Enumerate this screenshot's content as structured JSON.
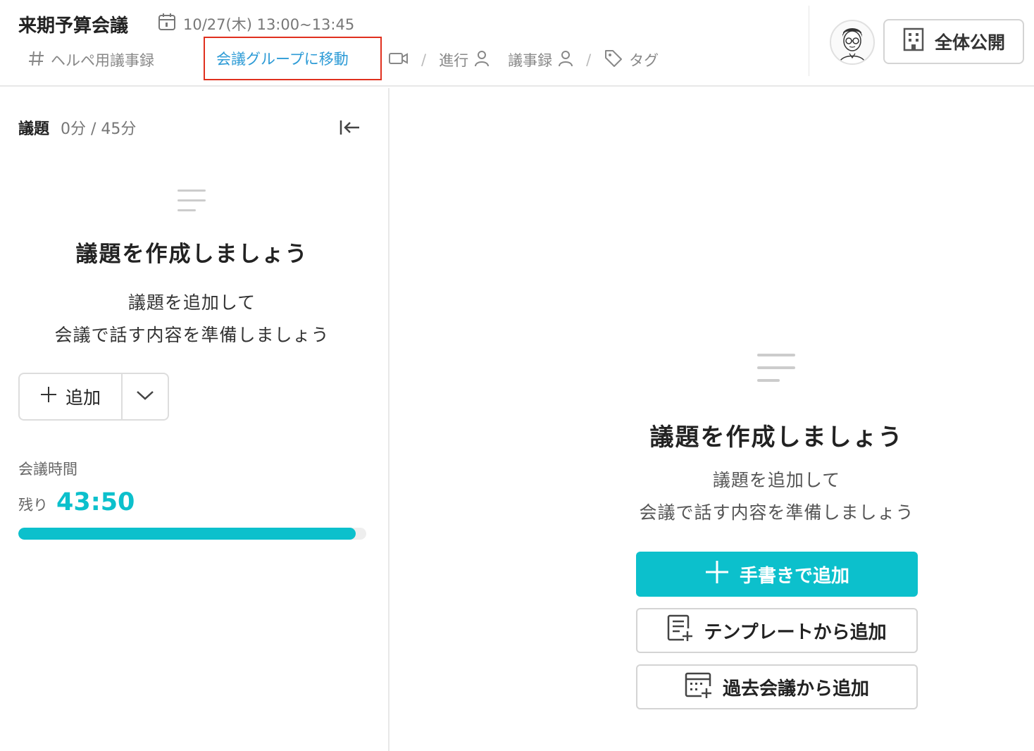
{
  "header": {
    "title": "来期予算会議",
    "datetime": "10/27(木) 13:00~13:45",
    "channel": "ヘルペ用議事録",
    "group_link": "会議グループに移動",
    "sep": "/",
    "progress_label": "進行",
    "minutes_label": "議事録",
    "tag_label": "タグ",
    "public_button": "全体公開"
  },
  "left_panel": {
    "agenda_label": "議題",
    "agenda_time": "0分 / 45分",
    "empty_title": "議題を作成しましょう",
    "empty_desc_1": "議題を追加して",
    "empty_desc_2": "会議で話す内容を準備しましょう",
    "add_label": "追加",
    "meeting_time_label": "会議時間",
    "remaining_label": "残り",
    "remaining_value": "43:50",
    "remaining_progress": 0.97
  },
  "right_panel": {
    "empty_title": "議題を作成しましょう",
    "empty_desc_1": "議題を追加して",
    "empty_desc_2": "会議で話す内容を準備しましょう",
    "handwrite_button": "手書きで追加",
    "template_button": "テンプレートから追加",
    "past_button": "過去会議から追加"
  },
  "colors": {
    "accent": "#0cc0cc",
    "link": "#2d9bd6",
    "highlight_border": "#e0301e"
  }
}
